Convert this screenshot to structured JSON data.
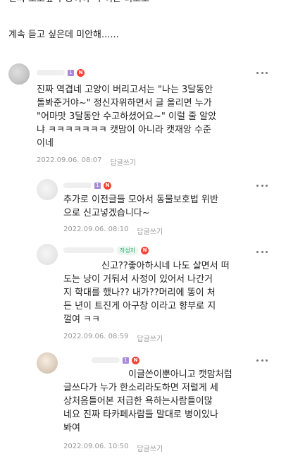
{
  "post": {
    "cut_line": "진짜 오고싶다 냥이야 다 이쁜 녀오오",
    "line": "계속 듣고 싶은데 미안해......"
  },
  "comments": [
    {
      "level_badge": "1",
      "new_badge": "N",
      "text": "진짜 역겹네 고양이 버리고서는 \"나는 3달동안\n돌봐준거야~\" 정신자위하면서 글 올리면 누가\n\"어마맛 3달동안 수고하셨어요~\" 이럴 줄 알았\n냐 ㅋㅋㅋㅋㅋㅋㅋ 캣맘이 아니라 캣재앙 수준\n이네",
      "time": "2022.09.06. 08:07",
      "reply": "답글쓰기"
    },
    {
      "level_badge": "1",
      "new_badge": "N",
      "text": "추가로 이전글들 모아서 동물보호법 위반\n으로 신고넣겠습니다~",
      "time": "2022.09.06. 08:10",
      "reply": "답글쓰기"
    },
    {
      "writer_tag": "작성자",
      "new_badge": "N",
      "text": "신고??좋아하시네 나도 살면서 떠\n도는 냥이 거둬서 사정이 있어서 나간거\n지 학대를 했나?? 내가??머리에 똥이 처\n든 년이 트진게 아구창 이라고 향부로 지\n껄여 ㅋㅋ",
      "time": "2022.09.06. 08:59",
      "reply": "답글쓰기"
    },
    {
      "level_badge": "1",
      "new_badge": "N",
      "text": "이글쓴이뿐아니고 캣맘처럼\n글쓰다가 누가 한소리라도하면 저럴게 세\n상처음들어본 저급한 욕하는사람들이많\n네요 진짜 타카페사람들 말대로 병이있나\n봐여",
      "time": "2022.09.06. 10:50",
      "reply": "답글쓰기"
    }
  ]
}
